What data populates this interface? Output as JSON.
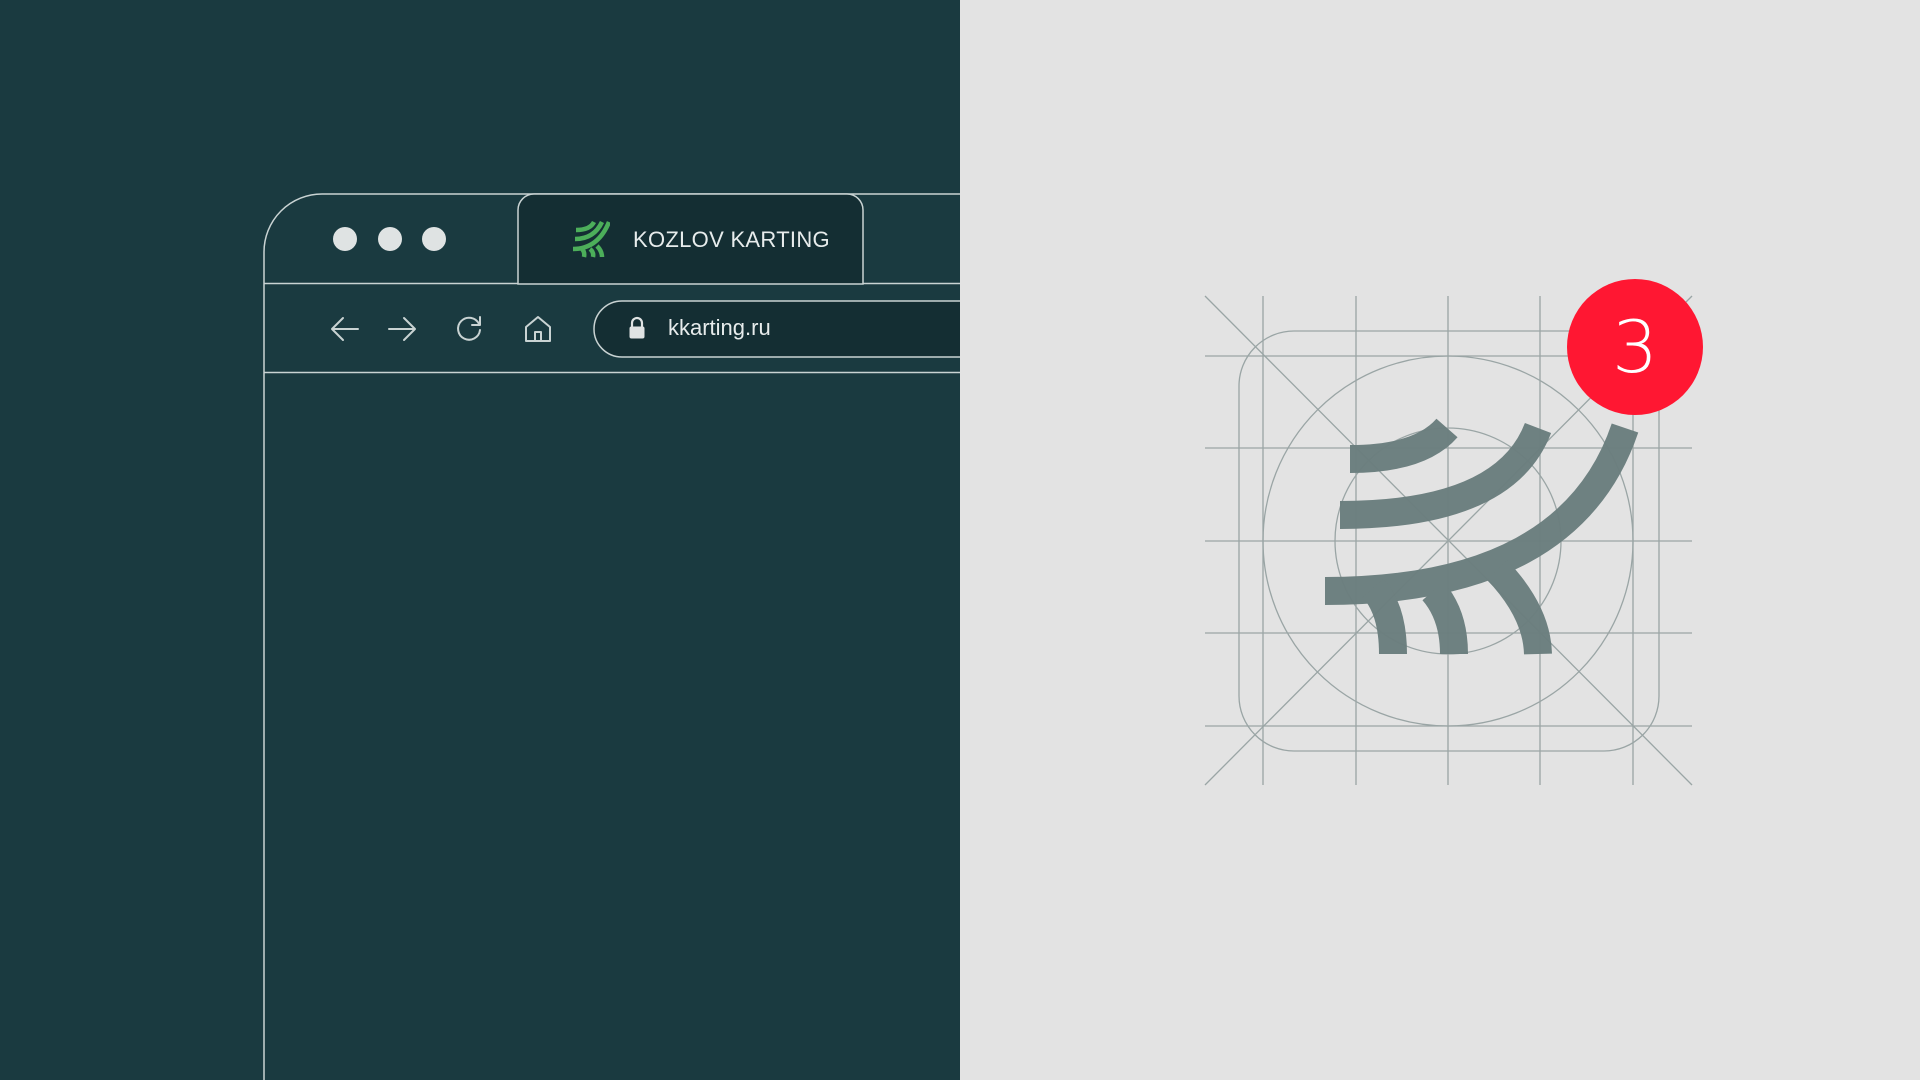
{
  "browser": {
    "window_controls": [
      "dot",
      "dot",
      "dot"
    ],
    "tab": {
      "title": "KOZLOV KARTING",
      "favicon": "kozlov-karting-logo-icon"
    },
    "toolbar": {
      "back_icon": "arrow-left-icon",
      "forward_icon": "arrow-right-icon",
      "reload_icon": "reload-icon",
      "home_icon": "home-icon"
    },
    "address_bar": {
      "url": "kkarting.ru",
      "lock_icon": "lock-icon"
    }
  },
  "app_icon": {
    "logo": "kozlov-karting-logo-icon",
    "notification_count": "3"
  },
  "colors": {
    "dark_bg": "#1a3a40",
    "light_bg": "#e3e3e3",
    "brand_green": "#4cae5a",
    "logo_gray": "#6b7e7e",
    "badge_red": "#ff1732",
    "outline": "#c9d3d3"
  }
}
